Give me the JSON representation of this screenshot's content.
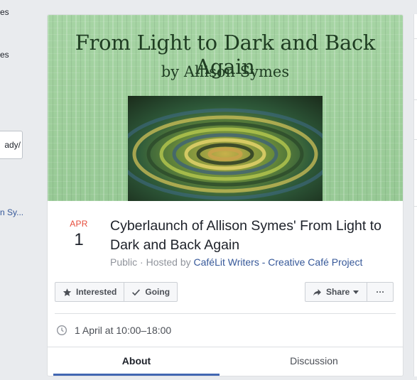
{
  "left_sidebar": {
    "fragment_1": "es",
    "fragment_2": "es",
    "box_text": "ady/",
    "link_fragment": "n Sy..."
  },
  "cover": {
    "title": "From Light to Dark and Back Again",
    "subtitle": "by Allison Symes"
  },
  "event": {
    "month": "APR",
    "day": "1",
    "title": "Cyberlaunch of Allison Symes' From Light to Dark and Back Again",
    "privacy": "Public",
    "hosted_by_prefix": "· Hosted by",
    "host_name": "CaféLit Writers - Creative Café Project",
    "datetime": "1 April at 10:00–18:00"
  },
  "actions": {
    "interested_label": "Interested",
    "going_label": "Going",
    "share_label": "Share",
    "more_label": "···"
  },
  "tabs": [
    {
      "label": "About",
      "active": true
    },
    {
      "label": "Discussion",
      "active": false
    }
  ],
  "colors": {
    "accent": "#4267b2",
    "date_month": "#e64c3b",
    "link": "#365899",
    "cover_green": "#a6d4a4"
  },
  "icons": {
    "interested": "star-icon",
    "going": "checkmark-icon",
    "share": "share-arrow-icon",
    "share_dropdown": "caret-down-icon",
    "time": "clock-icon"
  }
}
